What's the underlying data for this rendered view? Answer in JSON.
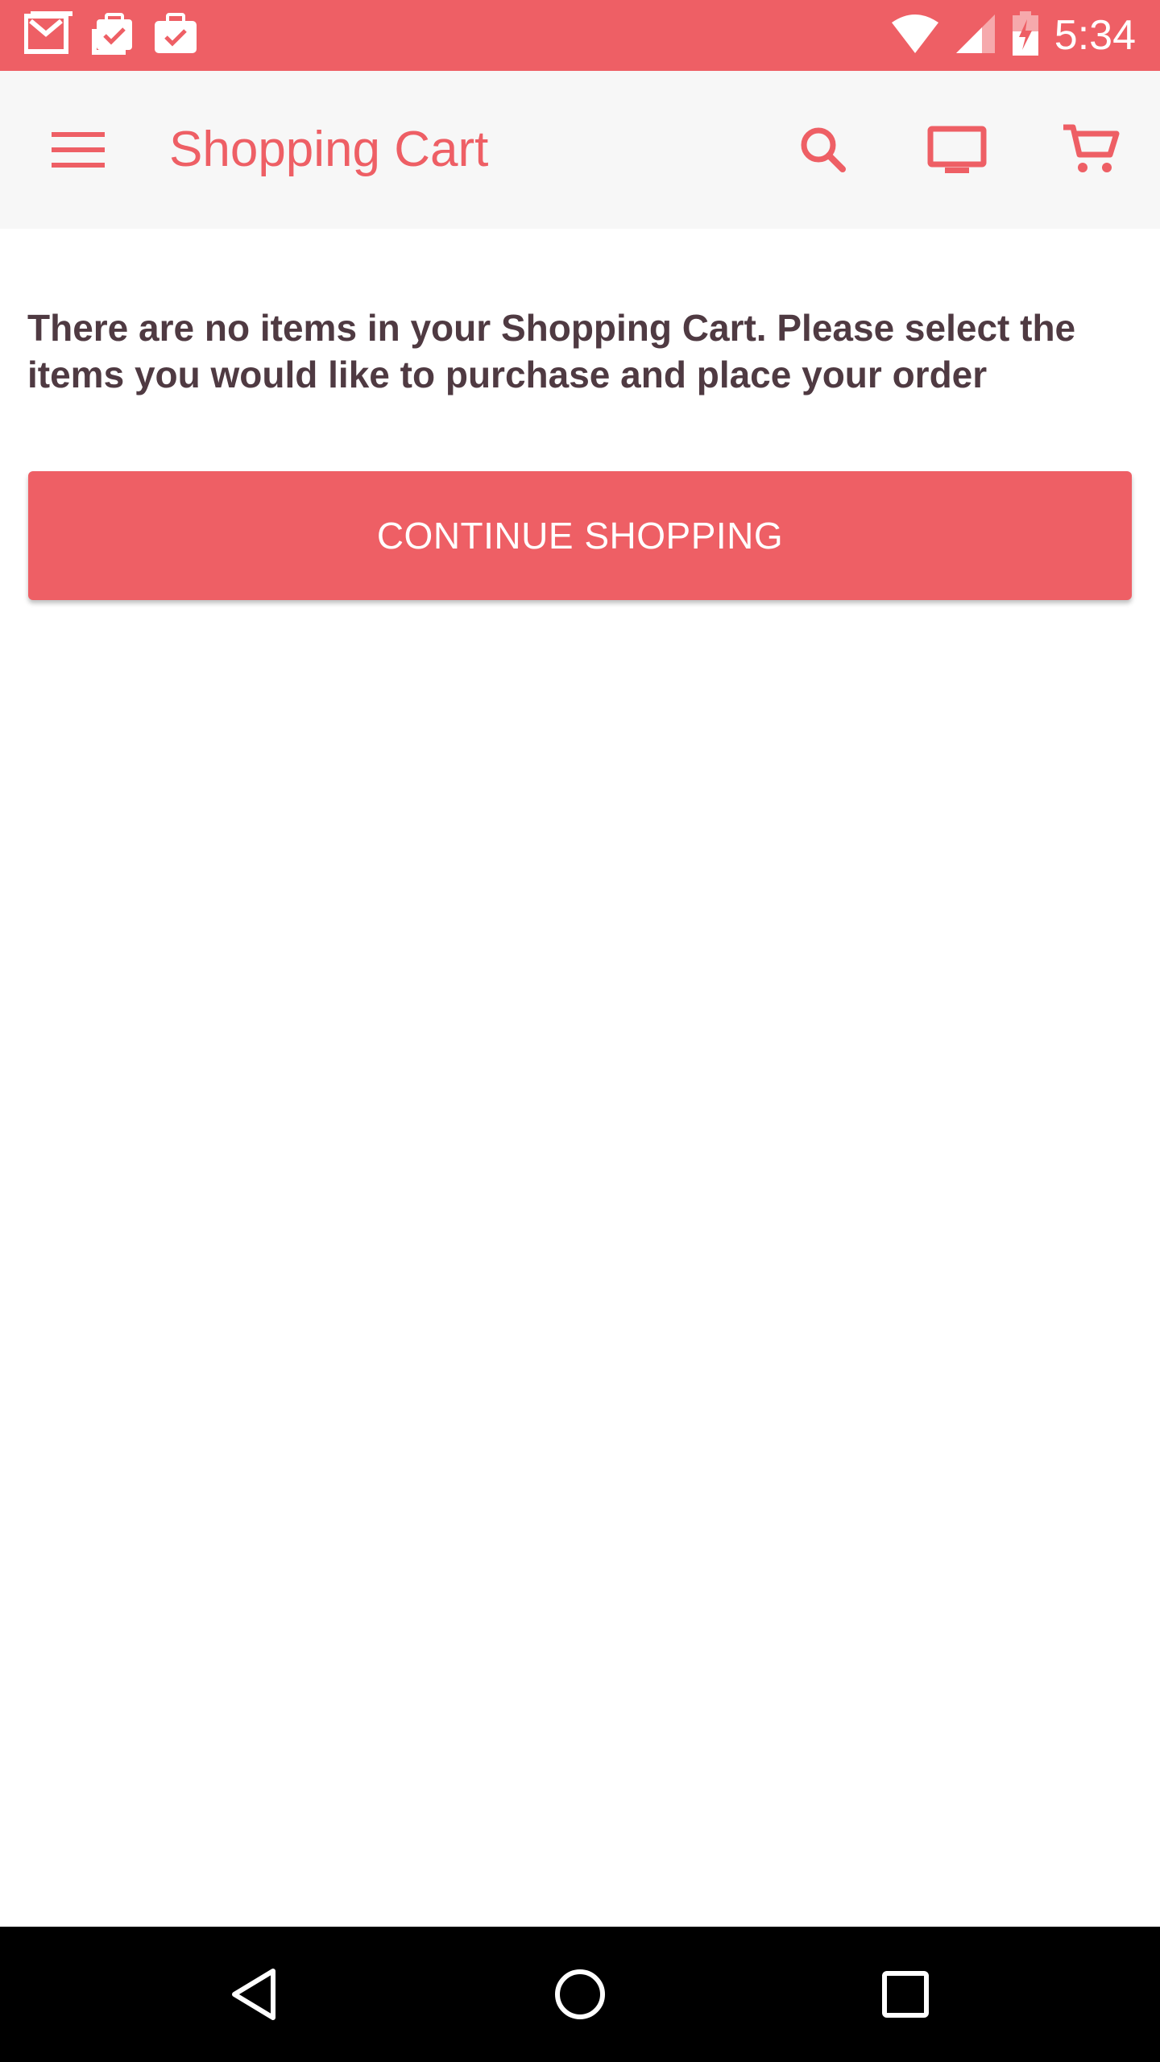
{
  "status_bar": {
    "time": "5:34",
    "left_icons": [
      "gmail-icon",
      "clipboard-check-icon",
      "briefcase-check-icon"
    ],
    "right_icons": [
      "wifi-icon",
      "cell-signal-icon",
      "battery-charging-icon"
    ],
    "color": "#ee5f65"
  },
  "toolbar": {
    "title": "Shopping Cart",
    "menu_icon": "menu-icon",
    "actions": [
      "search-icon",
      "tv-icon",
      "cart-icon"
    ],
    "accent": "#ee5f65"
  },
  "cart": {
    "empty_message": "There are no items in your Shopping Cart. Please select the items you would like to purchase and place your order",
    "continue_label": "CONTINUE SHOPPING"
  },
  "nav_bar": {
    "buttons": [
      "back-icon",
      "home-icon",
      "recents-icon"
    ]
  }
}
